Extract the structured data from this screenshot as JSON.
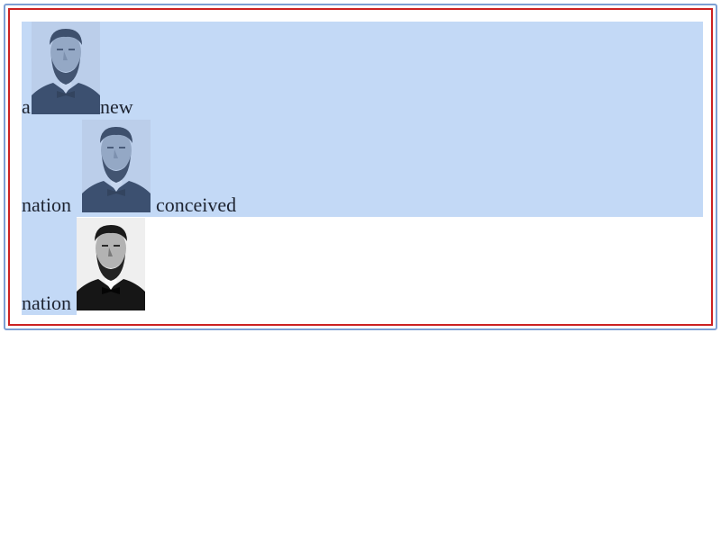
{
  "lines": [
    {
      "words": [
        "a",
        "new"
      ]
    },
    {
      "words": [
        "nation",
        "conceived"
      ]
    },
    {
      "words": [
        "nation"
      ]
    }
  ],
  "image_alt": "Abraham Lincoln portrait",
  "colors": {
    "selection": "#c3d9f6",
    "outer_border": "#7d9fd3",
    "inner_border": "#cc2222"
  }
}
